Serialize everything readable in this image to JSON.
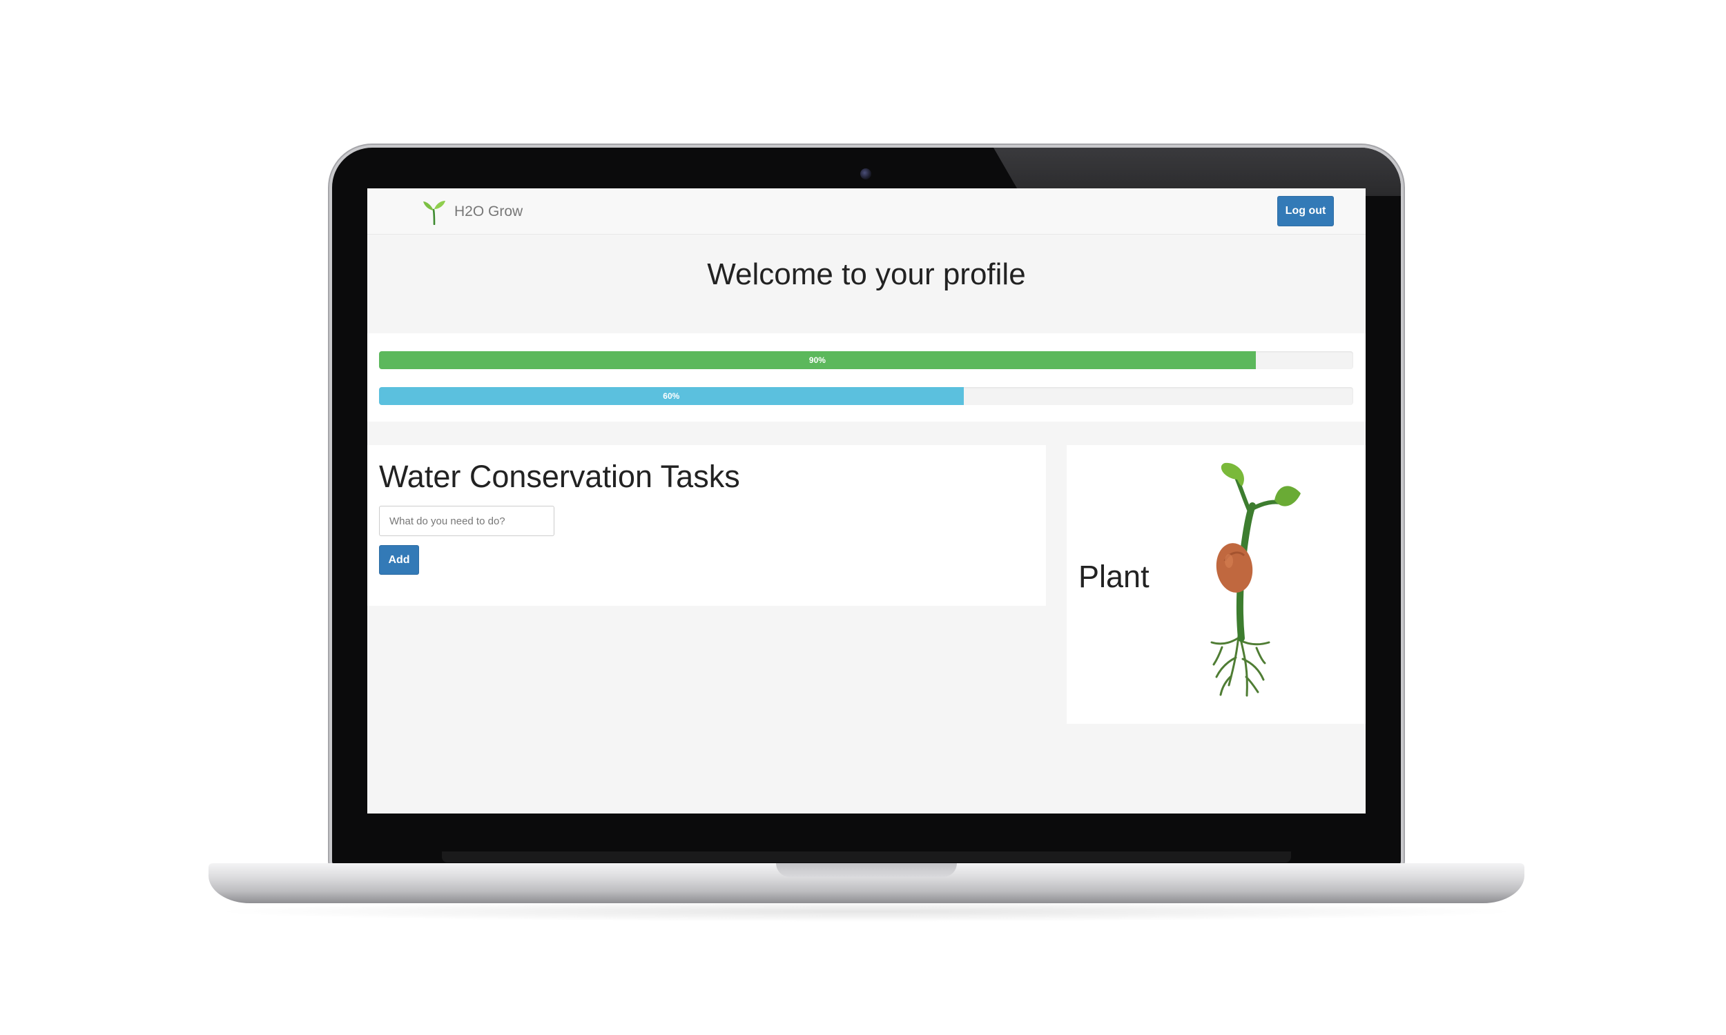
{
  "app": {
    "brand_name": "H2O Grow",
    "brand_icon": "sprout-icon",
    "accent_color": "#337ab7"
  },
  "navbar": {
    "logout_label": "Log out"
  },
  "header": {
    "title": "Welcome to your profile"
  },
  "progress": [
    {
      "label": "90%",
      "value": 0.9,
      "color": "#5cb85c"
    },
    {
      "label": "60%",
      "value": 0.6,
      "color": "#5bc0de"
    }
  ],
  "tasks": {
    "title": "Water Conservation Tasks",
    "input_placeholder": "What do you need to do?",
    "input_value": "",
    "add_label": "Add"
  },
  "plant": {
    "label": "Plant",
    "image": "seedling-illustration"
  }
}
